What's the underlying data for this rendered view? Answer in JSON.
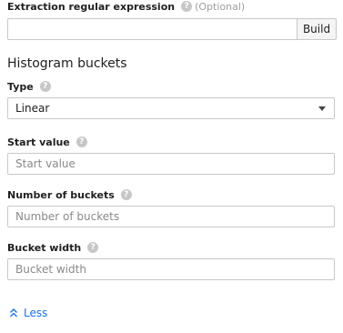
{
  "regex": {
    "label": "Extraction regular expression",
    "optional_text": "(Optional)",
    "value": "",
    "placeholder": "",
    "build_label": "Build"
  },
  "histogram": {
    "title": "Histogram buckets",
    "type": {
      "label": "Type",
      "selected": "Linear"
    },
    "start_value": {
      "label": "Start value",
      "placeholder": "Start value"
    },
    "number_of_buckets": {
      "label": "Number of buckets",
      "placeholder": "Number of buckets"
    },
    "bucket_width": {
      "label": "Bucket width",
      "placeholder": "Bucket width"
    }
  },
  "footer": {
    "less_label": "Less"
  },
  "icons": {
    "help": "help-circle-icon",
    "select_arrow": "caret-down-icon",
    "less": "double-chevron-up-icon"
  },
  "colors": {
    "link": "#1a73e8",
    "help_icon": "#c7c7c7",
    "border": "#c8c8c8"
  }
}
